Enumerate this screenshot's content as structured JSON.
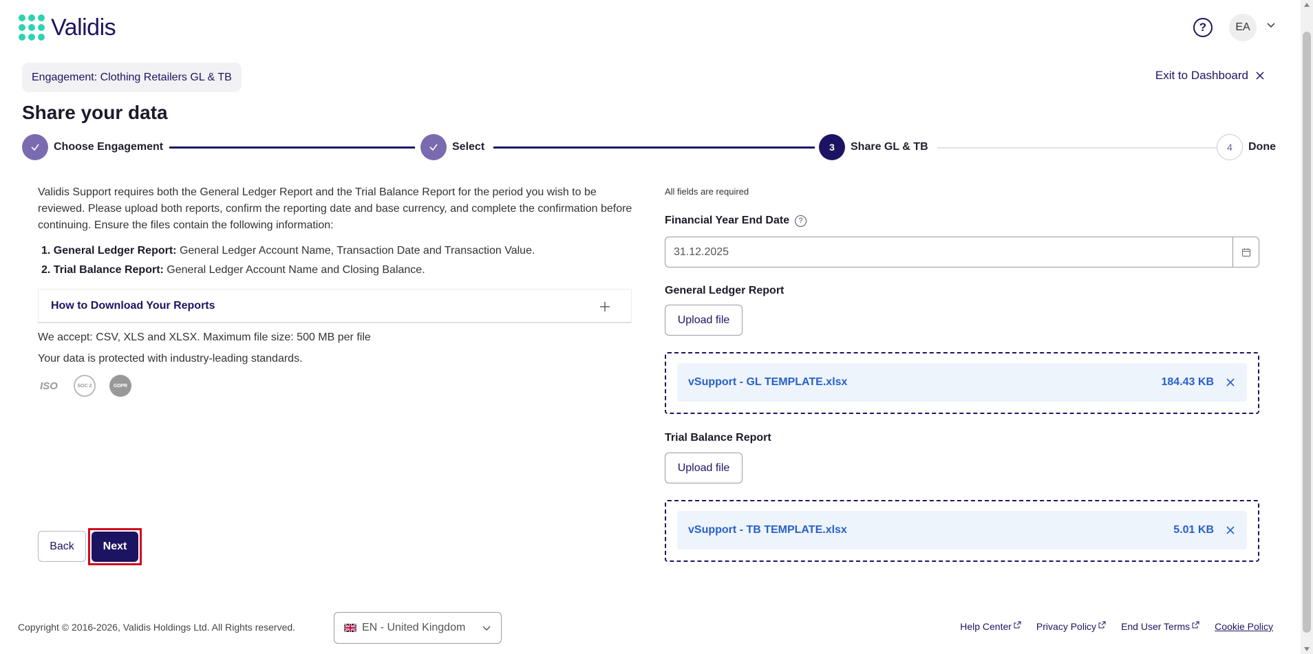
{
  "header": {
    "brand": "Validis",
    "help_icon": "question-circle-icon",
    "avatar_initials": "EA"
  },
  "engagement": {
    "chip_label": "Engagement: Clothing Retailers GL & TB",
    "exit_label": "Exit to Dashboard"
  },
  "page": {
    "title": "Share your data"
  },
  "stepper": {
    "steps": [
      {
        "number": "1",
        "label": "Choose Engagement",
        "state": "done"
      },
      {
        "number": "2",
        "label": "Select",
        "state": "done"
      },
      {
        "number": "3",
        "label": "Share GL & TB",
        "state": "active"
      },
      {
        "number": "4",
        "label": "Done",
        "state": "todo"
      }
    ]
  },
  "instructions": {
    "intro": "Validis Support requires both the General Ledger Report and the Trial Balance Report for the period you wish to be reviewed. Please upload both reports, confirm the reporting date and base currency, and complete the confirmation before continuing. Ensure the files contain the following information:",
    "items": [
      {
        "prefix": "1.",
        "title": "General Ledger Report:",
        "text": "General Ledger Account Name, Transaction Date and Transaction Value."
      },
      {
        "prefix": "2.",
        "title": "Trial Balance Report:",
        "text": "General Ledger Account Name and Closing Balance."
      }
    ],
    "accordion_title": "How to Download Your Reports",
    "accept": "We accept: CSV, XLS and XLSX. Maximum file size: 500 MB per file",
    "protected": "Your data is protected with industry-leading standards.",
    "badges": [
      "ISO",
      "SOC 2",
      "GDPR"
    ]
  },
  "actions": {
    "back_label": "Back",
    "next_label": "Next"
  },
  "form": {
    "required_note": "All fields are required",
    "fye_label": "Financial Year End Date",
    "fye_value": "31.12.2025",
    "gl_label": "General Ledger Report",
    "tb_label": "Trial Balance Report",
    "upload_label": "Upload file",
    "gl_file": {
      "name": "vSupport - GL TEMPLATE.xlsx",
      "size": "184.43 KB"
    },
    "tb_file": {
      "name": "vSupport - TB TEMPLATE.xlsx",
      "size": "5.01 KB"
    }
  },
  "footer": {
    "copyright": "Copyright © 2016-2026, Validis Holdings Ltd. All Rights reserved.",
    "language": "EN - United Kingdom",
    "links": [
      "Help Center",
      "Privacy Policy",
      "End User Terms",
      "Cookie Policy"
    ]
  },
  "colors": {
    "brand": "#1c1462",
    "accent_green": "#2ed3b0",
    "file_text": "#2860c8",
    "highlight": "#d0021b"
  }
}
